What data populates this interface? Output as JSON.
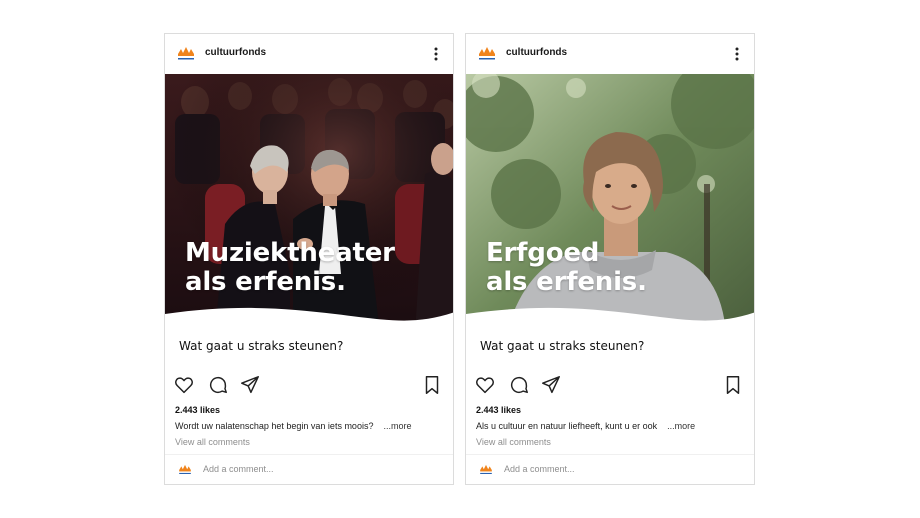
{
  "posts": [
    {
      "username": "cultuurfonds",
      "headline": "Muziektheater\nals erfenis.",
      "question": "Wat gaat u straks steunen?",
      "likes": "2.443 likes",
      "caption": "Wordt uw nalatenschap het begin van iets moois?",
      "more": "...more",
      "view_comments": "View all comments",
      "add_comment_placeholder": "Add a comment..."
    },
    {
      "username": "cultuurfonds",
      "headline": "Erfgoed\nals erfenis.",
      "question": "Wat gaat u straks steunen?",
      "likes": "2.443 likes",
      "caption": "Als u cultuur en natuur liefheeft, kunt u er ook",
      "more": "...more",
      "view_comments": "View all comments",
      "add_comment_placeholder": "Add a comment..."
    }
  ],
  "icons": {
    "like": "heart-icon",
    "comment": "comment-icon",
    "share": "send-icon",
    "save": "bookmark-icon",
    "options": "more-vertical-icon",
    "logo": "cultuurfonds-logo"
  },
  "colors": {
    "logo_orange": "#f0841c",
    "logo_blue": "#2a62b0"
  }
}
